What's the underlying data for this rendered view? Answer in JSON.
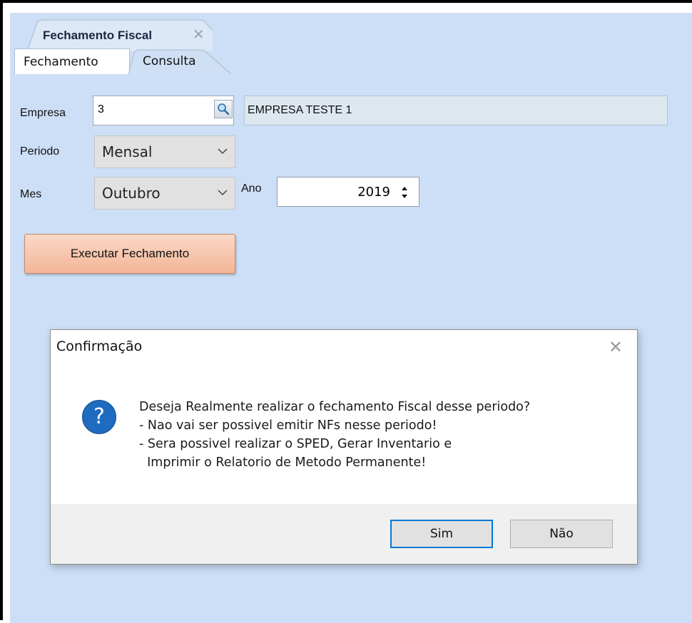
{
  "document_tab": {
    "title": "Fechamento Fiscal",
    "close_glyph": "✕"
  },
  "tabs": [
    {
      "label": "Fechamento",
      "active": true
    },
    {
      "label": "Consulta",
      "active": false
    }
  ],
  "form": {
    "empresa": {
      "label": "Empresa",
      "code": "3",
      "lookup_icon": "search-icon",
      "name": "EMPRESA TESTE 1"
    },
    "periodo": {
      "label": "Periodo",
      "selected": "Mensal"
    },
    "mes": {
      "label": "Mes",
      "selected": "Outubro"
    },
    "ano": {
      "label": "Ano",
      "value": "2019"
    },
    "execute_button": "Executar Fechamento"
  },
  "dialog": {
    "title": "Confirmação",
    "close_glyph": "✕",
    "icon": "question-icon",
    "icon_glyph": "?",
    "message_lines": [
      "Deseja Realmente realizar o fechamento Fiscal desse periodo?",
      "- Nao vai ser possivel emitir NFs nesse periodo!",
      "- Sera possivel realizar o SPED, Gerar Inventario e",
      "  Imprimir o Relatorio de Metodo Permanente!"
    ],
    "buttons": {
      "yes": "Sim",
      "no": "Não"
    }
  },
  "colors": {
    "panel_background": "#cddff6",
    "execute_button": "#f3b597",
    "question_icon": "#1e6bbf",
    "default_button_border": "#0078d7"
  }
}
